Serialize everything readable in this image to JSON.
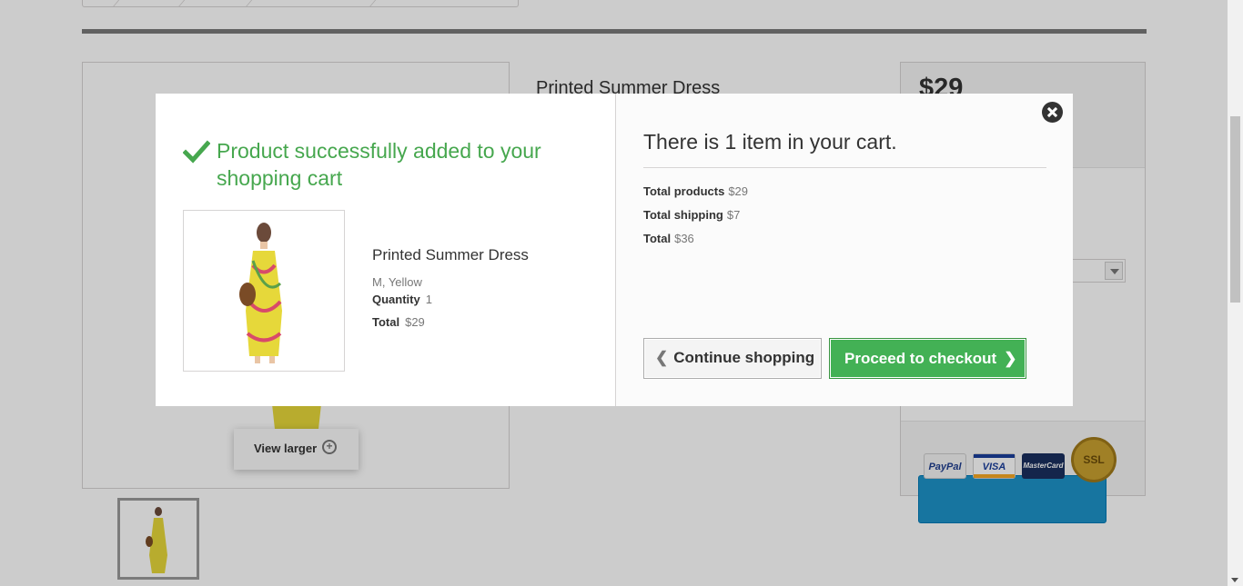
{
  "background": {
    "product_title": "Printed Summer Dress",
    "price": "$29",
    "view_larger": "View larger",
    "payment_cards": [
      "PayPal",
      "VISA",
      "MasterCard",
      "SSL"
    ]
  },
  "modal": {
    "success_message": "Product successfully added to your shopping cart",
    "product": {
      "name": "Printed Summer Dress",
      "attributes": "M, Yellow",
      "quantity_label": "Quantity",
      "quantity_value": "1",
      "total_label": "Total",
      "total_value": "$29"
    },
    "cart": {
      "count_text": "There is 1 item in your cart.",
      "total_products_label": "Total products",
      "total_products_value": "$29",
      "total_shipping_label": "Total shipping",
      "total_shipping_value": "$7",
      "total_label": "Total",
      "total_value": "$36"
    },
    "buttons": {
      "continue_label": "Continue shopping",
      "checkout_label": "Proceed to checkout"
    }
  },
  "colors": {
    "success_green": "#46a74e",
    "checkout_green": "#43b155",
    "add_to_cart_blue": "#1d93c8"
  }
}
